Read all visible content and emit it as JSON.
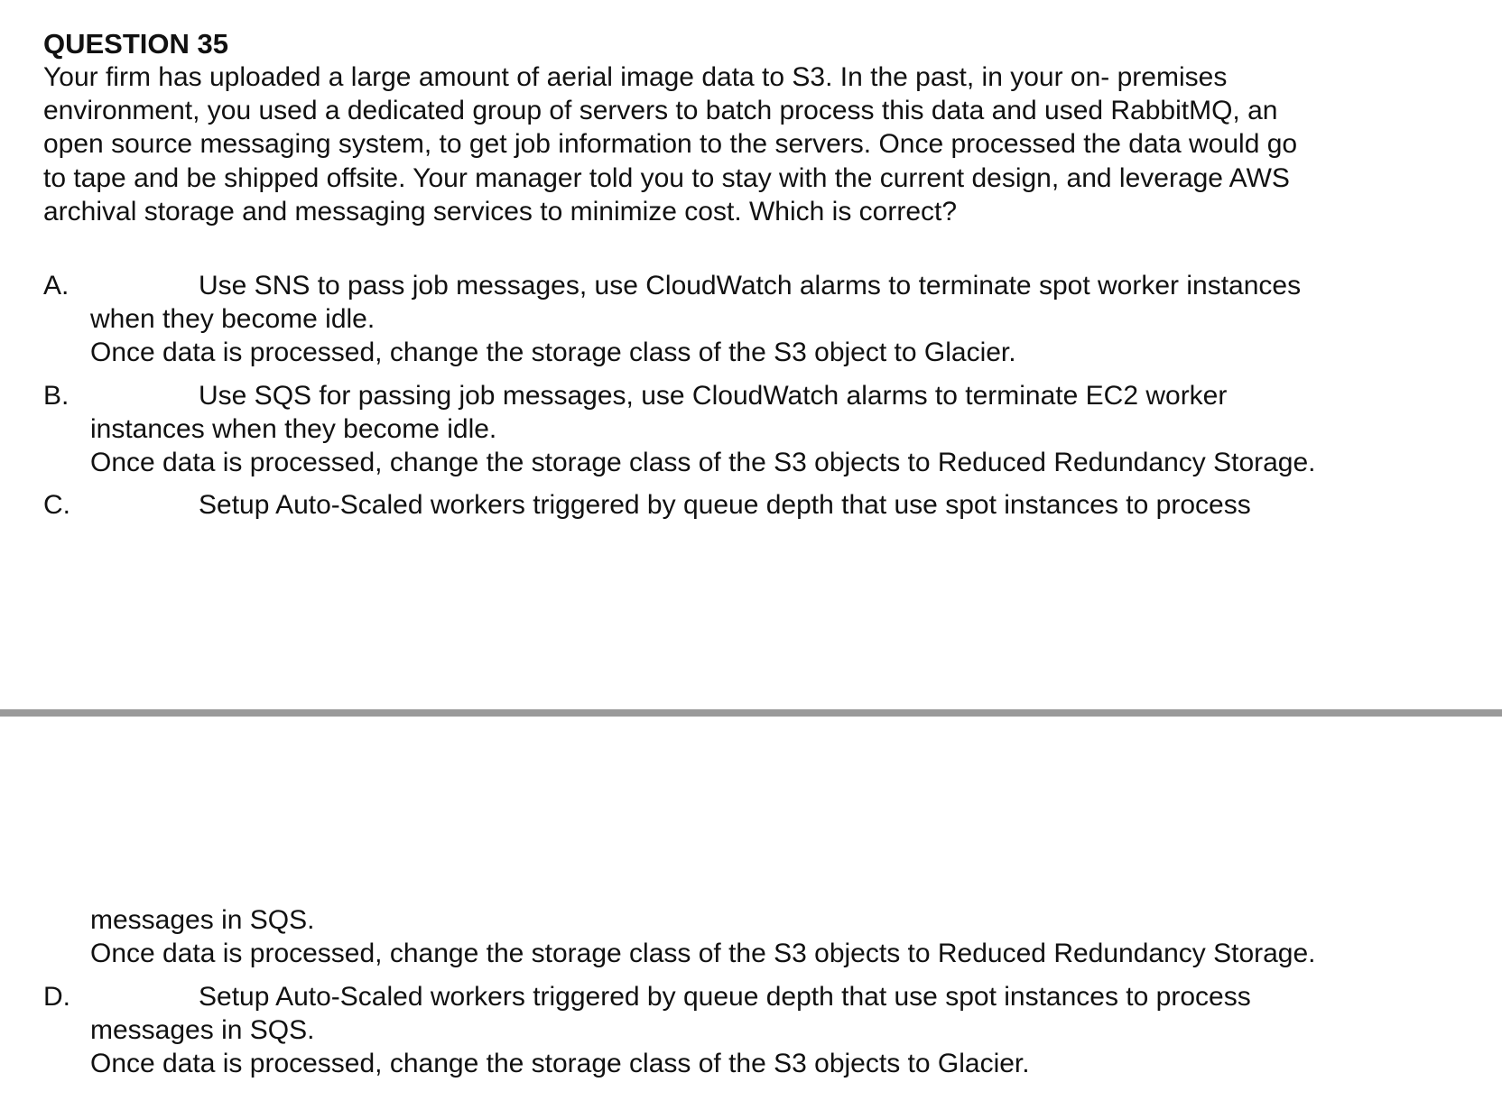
{
  "question": {
    "title": "QUESTION 35",
    "stem_lines": [
      "Your firm has uploaded a large amount of aerial image data to S3. In the past, in your on- premises",
      "environment, you used a dedicated group of servers to batch process this data and used RabbitMQ, an",
      "open source messaging system, to get job information to the servers. Once processed the data would go",
      "to tape and be shipped offsite. Your manager told you to stay with the current design, and leverage AWS",
      "archival storage and messaging services to minimize cost. Which is correct?"
    ]
  },
  "options": [
    {
      "letter": "A.",
      "first_line": "Use SNS to pass job messages, use CloudWatch alarms to terminate spot worker instances",
      "cont_lines": [
        "when they become idle.",
        "Once data is processed, change the storage class of the S3 object to Glacier."
      ]
    },
    {
      "letter": "B.",
      "first_line": "Use SQS for passing job messages, use CloudWatch alarms to terminate EC2 worker",
      "cont_lines": [
        "instances when they become idle.",
        "Once data is processed, change the storage class of the S3 objects to Reduced Redundancy Storage."
      ]
    },
    {
      "letter": "C.",
      "first_line": "Setup Auto-Scaled workers triggered by queue depth that use spot instances to process",
      "cont_lines": [
        "messages in SQS.",
        "Once data is processed, change the storage class of the S3 objects to Reduced Redundancy Storage."
      ]
    },
    {
      "letter": "D.",
      "first_line": "Setup Auto-Scaled workers triggered by queue depth that use spot instances to process",
      "cont_lines": [
        "messages in SQS.",
        "Once data is processed, change the storage class of the S3 objects to Glacier."
      ]
    }
  ]
}
